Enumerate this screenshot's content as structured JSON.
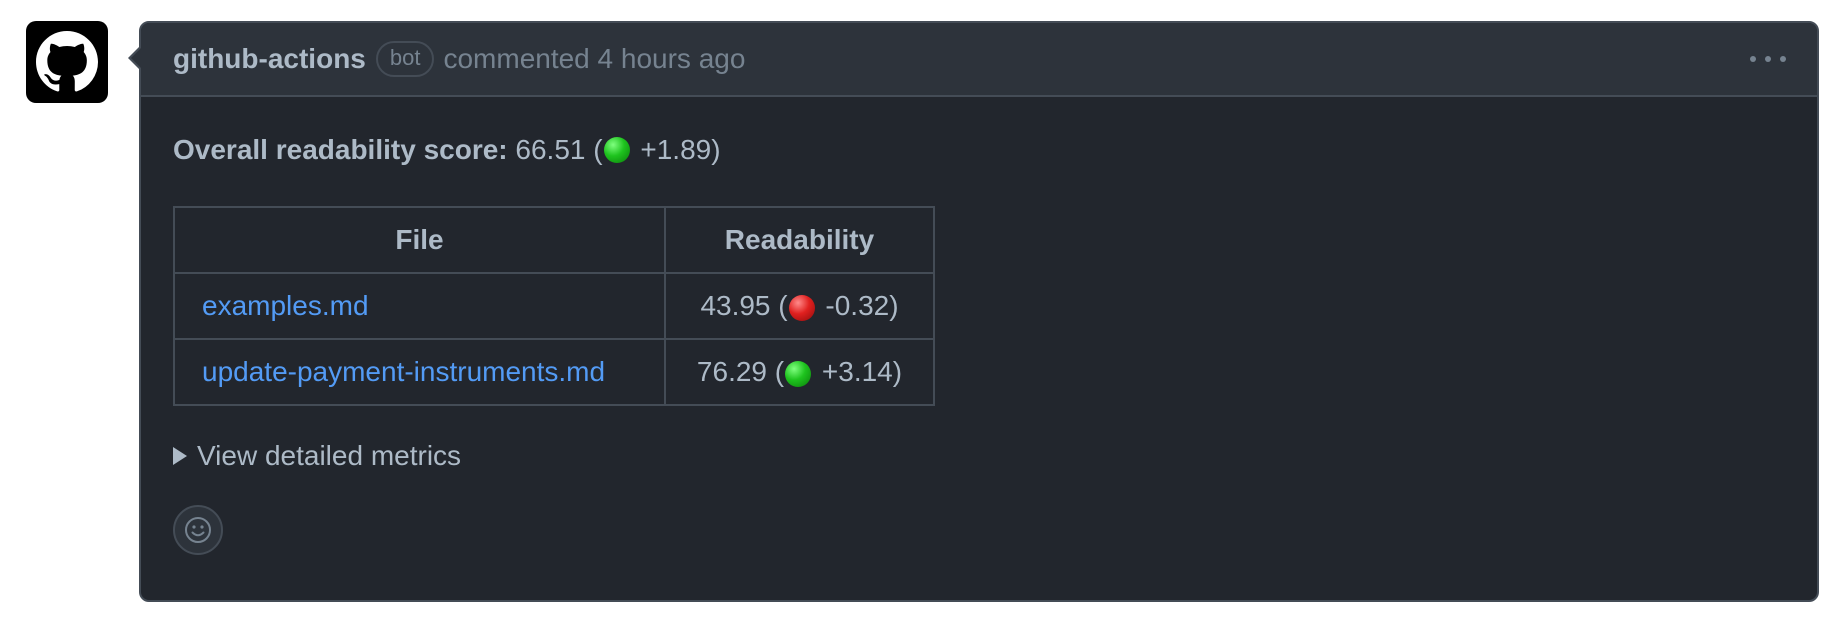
{
  "comment": {
    "author": "github-actions",
    "badge": "bot",
    "meta": "commented 4 hours ago",
    "menu_icon": "kebab-horizontal-icon",
    "avatar_icon": "github-octocat-icon"
  },
  "score": {
    "label": "Overall readability score:",
    "value": "66.51",
    "open_paren": " (",
    "indicator": "green-circle",
    "delta": "+1.89",
    "close_paren": ")"
  },
  "table": {
    "headers": [
      "File",
      "Readability"
    ],
    "rows": [
      {
        "file": "examples.md",
        "value": "43.95",
        "indicator": "red-circle",
        "delta": "-0.32"
      },
      {
        "file": "update-payment-instruments.md",
        "value": "76.29",
        "indicator": "green-circle",
        "delta": "+3.14"
      }
    ]
  },
  "details": {
    "summary": "View detailed metrics"
  },
  "reactions": {
    "icon": "smiley-icon"
  },
  "colors": {
    "background": "#22262d",
    "header": "#2d333b",
    "border": "#444c56",
    "text": "#adbac7",
    "muted": "#768390",
    "link": "#539bf5"
  }
}
